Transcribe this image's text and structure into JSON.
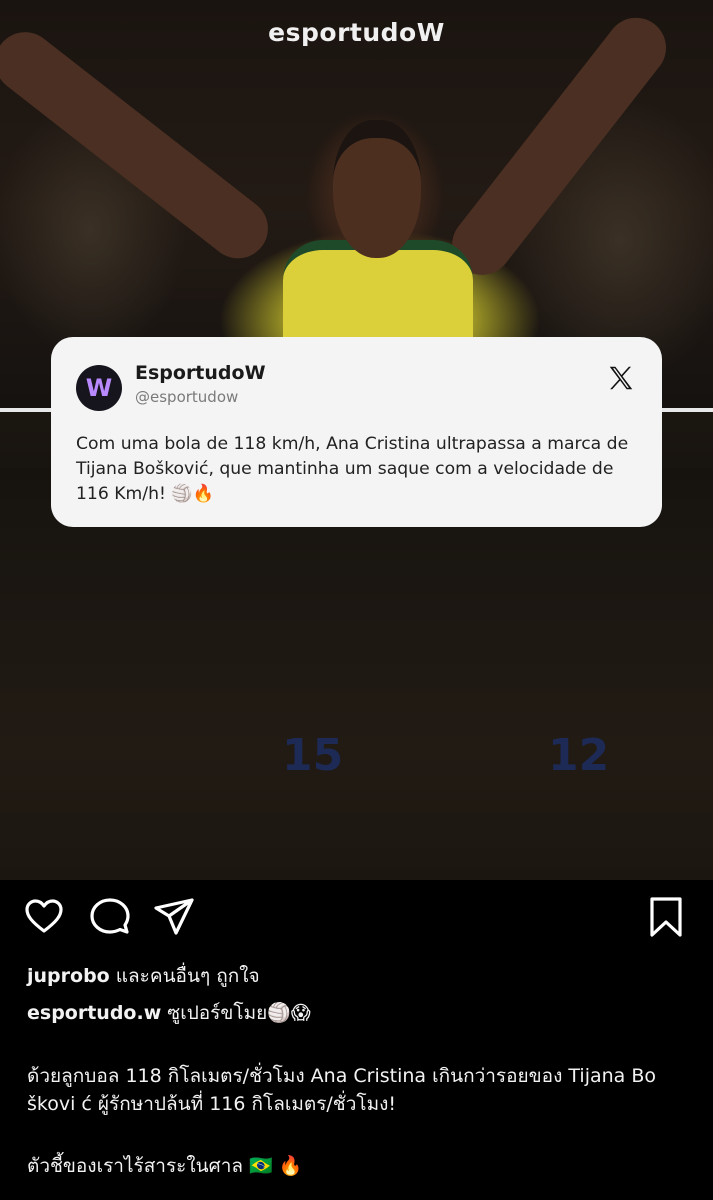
{
  "post": {
    "brand_logo": "esportudoW",
    "photo_top_alt": "player arms raised",
    "numbers": [
      "15",
      "12"
    ]
  },
  "tweet": {
    "avatar_letter": "W",
    "name": "EsportudoW",
    "handle": "@esportudow",
    "text": "Com uma bola de 118 km/h, Ana Cristina ultrapassa a marca de Tijana Bošković, que mantinha um saque com a velocidade de 116 Km/h! 🏐🔥"
  },
  "actions": {
    "like_icon": "heart-icon",
    "comment_icon": "comment-icon",
    "share_icon": "send-icon",
    "save_icon": "bookmark-icon"
  },
  "likes": {
    "user": "juprobo",
    "rest": " และคนอื่นๆ ถูกใจ"
  },
  "caption": {
    "username": "esportudo.w",
    "first_line": " ซูเปอร์ขโมย🏐😱",
    "paragraph": "ด้วยลูกบอล 118 กิโลเมตร/ชั่วโมง Ana Cristina เกินกว่ารอยของ Tijana Bo škovi ć ผู้รักษาปล้นที่ 116 กิโลเมตร/ชั่วโมง!",
    "last_line": "ตัวชี้ของเราไร้สาระในศาล 🇧🇷 🔥"
  }
}
